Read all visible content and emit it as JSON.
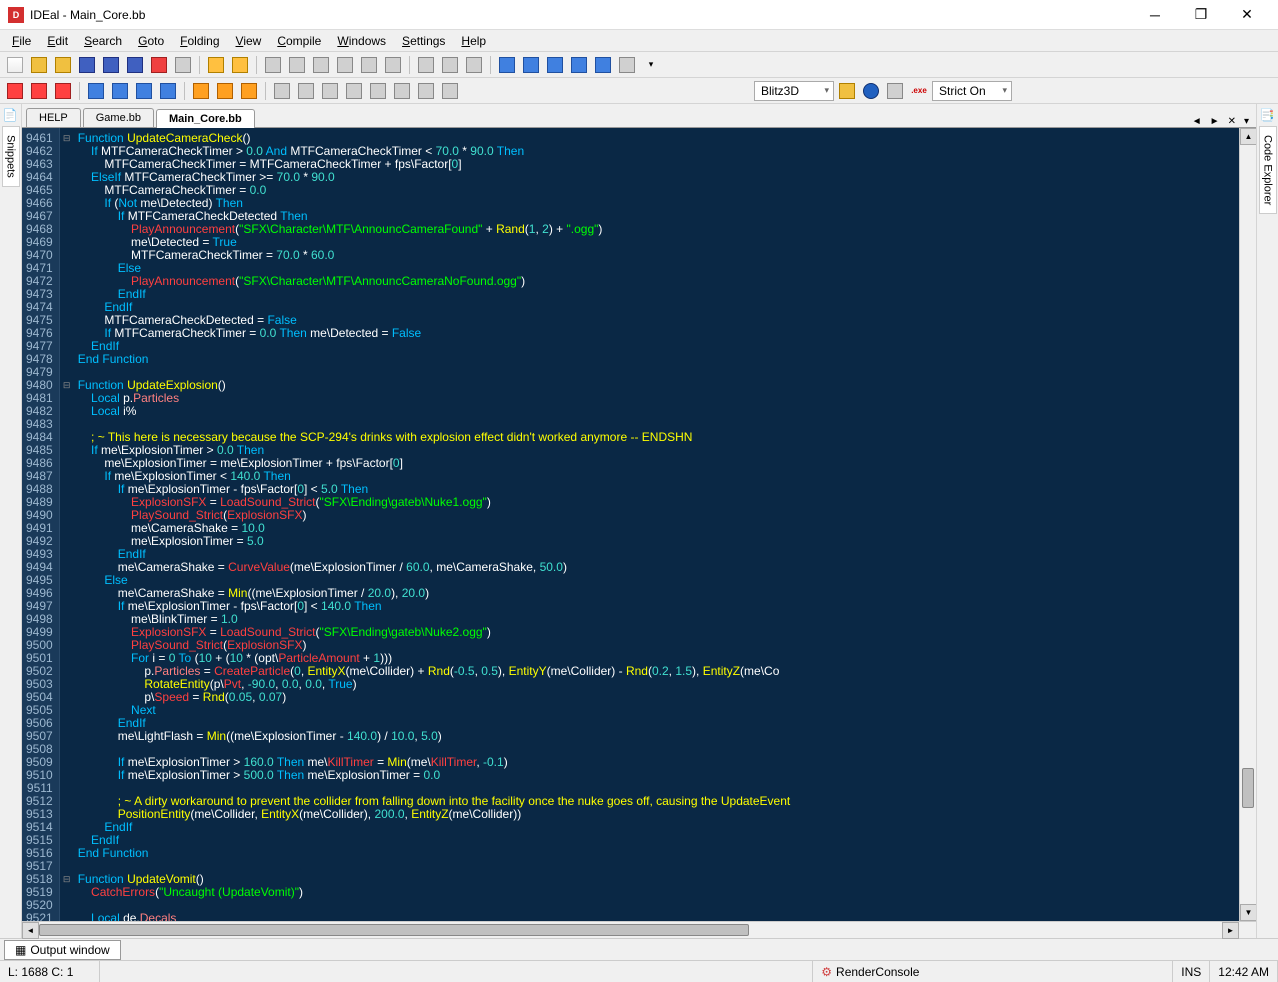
{
  "window": {
    "title": "IDEal - Main_Core.bb",
    "app_icon_text": "D"
  },
  "menu": {
    "items": [
      "File",
      "Edit",
      "Search",
      "Goto",
      "Folding",
      "View",
      "Compile",
      "Windows",
      "Settings",
      "Help"
    ]
  },
  "toolbar2": {
    "compiler": "Blitz3D",
    "strict": "Strict On"
  },
  "side_left": {
    "label": "Snippets"
  },
  "side_right": {
    "label": "Code Explorer"
  },
  "tabs": {
    "items": [
      "HELP",
      "Game.bb",
      "Main_Core.bb"
    ],
    "active_index": 2
  },
  "gutter": {
    "start": 9461,
    "end": 9521
  },
  "code_lines": [
    [
      [
        "kw",
        "Function "
      ],
      [
        "fn",
        "UpdateCameraCheck"
      ],
      [
        "op",
        "()"
      ]
    ],
    [
      [
        "op",
        "    "
      ],
      [
        "kw",
        "If"
      ],
      [
        "op",
        " MTFCameraCheckTimer > "
      ],
      [
        "num",
        "0.0"
      ],
      [
        "op",
        " "
      ],
      [
        "kw",
        "And"
      ],
      [
        "op",
        " MTFCameraCheckTimer < "
      ],
      [
        "num",
        "70.0"
      ],
      [
        "op",
        " * "
      ],
      [
        "num",
        "90.0"
      ],
      [
        "op",
        " "
      ],
      [
        "kw",
        "Then"
      ]
    ],
    [
      [
        "op",
        "        MTFCameraCheckTimer = MTFCameraCheckTimer + fps\\Factor["
      ],
      [
        "num",
        "0"
      ],
      [
        "op",
        "]"
      ]
    ],
    [
      [
        "op",
        "    "
      ],
      [
        "kw",
        "ElseIf"
      ],
      [
        "op",
        " MTFCameraCheckTimer >= "
      ],
      [
        "num",
        "70.0"
      ],
      [
        "op",
        " * "
      ],
      [
        "num",
        "90.0"
      ]
    ],
    [
      [
        "op",
        "        MTFCameraCheckTimer = "
      ],
      [
        "num",
        "0.0"
      ]
    ],
    [
      [
        "op",
        "        "
      ],
      [
        "kw",
        "If"
      ],
      [
        "op",
        " ("
      ],
      [
        "kw",
        "Not"
      ],
      [
        "op",
        " me\\Detected) "
      ],
      [
        "kw",
        "Then"
      ]
    ],
    [
      [
        "op",
        "            "
      ],
      [
        "kw",
        "If"
      ],
      [
        "op",
        " MTFCameraCheckDetected "
      ],
      [
        "kw",
        "Then"
      ]
    ],
    [
      [
        "op",
        "                "
      ],
      [
        "err",
        "PlayAnnouncement"
      ],
      [
        "op",
        "("
      ],
      [
        "str",
        "\"SFX\\Character\\MTF\\AnnouncCameraFound\""
      ],
      [
        "op",
        " + "
      ],
      [
        "fn",
        "Rand"
      ],
      [
        "op",
        "("
      ],
      [
        "num",
        "1"
      ],
      [
        "op",
        ", "
      ],
      [
        "num",
        "2"
      ],
      [
        "op",
        ") + "
      ],
      [
        "str",
        "\".ogg\""
      ],
      [
        "op",
        ")"
      ]
    ],
    [
      [
        "op",
        "                me\\Detected = "
      ],
      [
        "kw",
        "True"
      ]
    ],
    [
      [
        "op",
        "                MTFCameraCheckTimer = "
      ],
      [
        "num",
        "70.0"
      ],
      [
        "op",
        " * "
      ],
      [
        "num",
        "60.0"
      ]
    ],
    [
      [
        "op",
        "            "
      ],
      [
        "kw",
        "Else"
      ]
    ],
    [
      [
        "op",
        "                "
      ],
      [
        "err",
        "PlayAnnouncement"
      ],
      [
        "op",
        "("
      ],
      [
        "str",
        "\"SFX\\Character\\MTF\\AnnouncCameraNoFound.ogg\""
      ],
      [
        "op",
        ")"
      ]
    ],
    [
      [
        "op",
        "            "
      ],
      [
        "kw",
        "EndIf"
      ]
    ],
    [
      [
        "op",
        "        "
      ],
      [
        "kw",
        "EndIf"
      ]
    ],
    [
      [
        "op",
        "        MTFCameraCheckDetected = "
      ],
      [
        "kw",
        "False"
      ]
    ],
    [
      [
        "op",
        "        "
      ],
      [
        "kw",
        "If"
      ],
      [
        "op",
        " MTFCameraCheckTimer = "
      ],
      [
        "num",
        "0.0"
      ],
      [
        "op",
        " "
      ],
      [
        "kw",
        "Then"
      ],
      [
        "op",
        " me\\Detected = "
      ],
      [
        "kw",
        "False"
      ]
    ],
    [
      [
        "op",
        "    "
      ],
      [
        "kw",
        "EndIf"
      ]
    ],
    [
      [
        "kw",
        "End Function"
      ]
    ],
    [
      [
        "op",
        ""
      ]
    ],
    [
      [
        "kw",
        "Function "
      ],
      [
        "fn",
        "UpdateExplosion"
      ],
      [
        "op",
        "()"
      ]
    ],
    [
      [
        "op",
        "    "
      ],
      [
        "kw",
        "Local"
      ],
      [
        "op",
        " p."
      ],
      [
        "typ",
        "Particles"
      ]
    ],
    [
      [
        "op",
        "    "
      ],
      [
        "kw",
        "Local"
      ],
      [
        "op",
        " i%"
      ]
    ],
    [
      [
        "op",
        ""
      ]
    ],
    [
      [
        "op",
        "    "
      ],
      [
        "cmt",
        "; ~ This here is necessary because the SCP-294's drinks with explosion effect didn't worked anymore -- ENDSHN"
      ]
    ],
    [
      [
        "op",
        "    "
      ],
      [
        "kw",
        "If"
      ],
      [
        "op",
        " me\\ExplosionTimer > "
      ],
      [
        "num",
        "0.0"
      ],
      [
        "op",
        " "
      ],
      [
        "kw",
        "Then"
      ]
    ],
    [
      [
        "op",
        "        me\\ExplosionTimer = me\\ExplosionTimer + fps\\Factor["
      ],
      [
        "num",
        "0"
      ],
      [
        "op",
        "]"
      ]
    ],
    [
      [
        "op",
        "        "
      ],
      [
        "kw",
        "If"
      ],
      [
        "op",
        " me\\ExplosionTimer < "
      ],
      [
        "num",
        "140.0"
      ],
      [
        "op",
        " "
      ],
      [
        "kw",
        "Then"
      ]
    ],
    [
      [
        "op",
        "            "
      ],
      [
        "kw",
        "If"
      ],
      [
        "op",
        " me\\ExplosionTimer - fps\\Factor["
      ],
      [
        "num",
        "0"
      ],
      [
        "op",
        "] < "
      ],
      [
        "num",
        "5.0"
      ],
      [
        "op",
        " "
      ],
      [
        "kw",
        "Then"
      ]
    ],
    [
      [
        "op",
        "                "
      ],
      [
        "err",
        "ExplosionSFX"
      ],
      [
        "op",
        " = "
      ],
      [
        "err",
        "LoadSound_Strict"
      ],
      [
        "op",
        "("
      ],
      [
        "str",
        "\"SFX\\Ending\\gateb\\Nuke1.ogg\""
      ],
      [
        "op",
        ")"
      ]
    ],
    [
      [
        "op",
        "                "
      ],
      [
        "err",
        "PlaySound_Strict"
      ],
      [
        "op",
        "("
      ],
      [
        "err",
        "ExplosionSFX"
      ],
      [
        "op",
        ")"
      ]
    ],
    [
      [
        "op",
        "                me\\CameraShake = "
      ],
      [
        "num",
        "10.0"
      ]
    ],
    [
      [
        "op",
        "                me\\ExplosionTimer = "
      ],
      [
        "num",
        "5.0"
      ]
    ],
    [
      [
        "op",
        "            "
      ],
      [
        "kw",
        "EndIf"
      ]
    ],
    [
      [
        "op",
        "            me\\CameraShake = "
      ],
      [
        "err",
        "CurveValue"
      ],
      [
        "op",
        "(me\\ExplosionTimer / "
      ],
      [
        "num",
        "60.0"
      ],
      [
        "op",
        ", me\\CameraShake, "
      ],
      [
        "num",
        "50.0"
      ],
      [
        "op",
        ")"
      ]
    ],
    [
      [
        "op",
        "        "
      ],
      [
        "kw",
        "Else"
      ]
    ],
    [
      [
        "op",
        "            me\\CameraShake = "
      ],
      [
        "fn",
        "Min"
      ],
      [
        "op",
        "((me\\ExplosionTimer / "
      ],
      [
        "num",
        "20.0"
      ],
      [
        "op",
        "), "
      ],
      [
        "num",
        "20.0"
      ],
      [
        "op",
        ")"
      ]
    ],
    [
      [
        "op",
        "            "
      ],
      [
        "kw",
        "If"
      ],
      [
        "op",
        " me\\ExplosionTimer - fps\\Factor["
      ],
      [
        "num",
        "0"
      ],
      [
        "op",
        "] < "
      ],
      [
        "num",
        "140.0"
      ],
      [
        "op",
        " "
      ],
      [
        "kw",
        "Then"
      ]
    ],
    [
      [
        "op",
        "                me\\BlinkTimer = "
      ],
      [
        "num",
        "1.0"
      ]
    ],
    [
      [
        "op",
        "                "
      ],
      [
        "err",
        "ExplosionSFX"
      ],
      [
        "op",
        " = "
      ],
      [
        "err",
        "LoadSound_Strict"
      ],
      [
        "op",
        "("
      ],
      [
        "str",
        "\"SFX\\Ending\\gateb\\Nuke2.ogg\""
      ],
      [
        "op",
        ")"
      ]
    ],
    [
      [
        "op",
        "                "
      ],
      [
        "err",
        "PlaySound_Strict"
      ],
      [
        "op",
        "("
      ],
      [
        "err",
        "ExplosionSFX"
      ],
      [
        "op",
        ")"
      ]
    ],
    [
      [
        "op",
        "                "
      ],
      [
        "kw",
        "For"
      ],
      [
        "op",
        " i = "
      ],
      [
        "num",
        "0"
      ],
      [
        "op",
        " "
      ],
      [
        "kw",
        "To"
      ],
      [
        "op",
        " ("
      ],
      [
        "num",
        "10"
      ],
      [
        "op",
        " + ("
      ],
      [
        "num",
        "10"
      ],
      [
        "op",
        " * (opt\\"
      ],
      [
        "err",
        "ParticleAmount"
      ],
      [
        "op",
        " + "
      ],
      [
        "num",
        "1"
      ],
      [
        "op",
        ")))"
      ]
    ],
    [
      [
        "op",
        "                    p."
      ],
      [
        "typ",
        "Particles"
      ],
      [
        "op",
        " = "
      ],
      [
        "err",
        "CreateParticle"
      ],
      [
        "op",
        "("
      ],
      [
        "num",
        "0"
      ],
      [
        "op",
        ", "
      ],
      [
        "fn",
        "EntityX"
      ],
      [
        "op",
        "(me\\Collider) + "
      ],
      [
        "fn",
        "Rnd"
      ],
      [
        "op",
        "("
      ],
      [
        "num",
        "-0.5"
      ],
      [
        "op",
        ", "
      ],
      [
        "num",
        "0.5"
      ],
      [
        "op",
        "), "
      ],
      [
        "fn",
        "EntityY"
      ],
      [
        "op",
        "(me\\Collider) - "
      ],
      [
        "fn",
        "Rnd"
      ],
      [
        "op",
        "("
      ],
      [
        "num",
        "0.2"
      ],
      [
        "op",
        ", "
      ],
      [
        "num",
        "1.5"
      ],
      [
        "op",
        "), "
      ],
      [
        "fn",
        "EntityZ"
      ],
      [
        "op",
        "(me\\Co"
      ]
    ],
    [
      [
        "op",
        "                    "
      ],
      [
        "fn",
        "RotateEntity"
      ],
      [
        "op",
        "(p\\"
      ],
      [
        "err",
        "Pvt"
      ],
      [
        "op",
        ", "
      ],
      [
        "num",
        "-90.0"
      ],
      [
        "op",
        ", "
      ],
      [
        "num",
        "0.0"
      ],
      [
        "op",
        ", "
      ],
      [
        "num",
        "0.0"
      ],
      [
        "op",
        ", "
      ],
      [
        "kw",
        "True"
      ],
      [
        "op",
        ")"
      ]
    ],
    [
      [
        "op",
        "                    p\\"
      ],
      [
        "err",
        "Speed"
      ],
      [
        "op",
        " = "
      ],
      [
        "fn",
        "Rnd"
      ],
      [
        "op",
        "("
      ],
      [
        "num",
        "0.05"
      ],
      [
        "op",
        ", "
      ],
      [
        "num",
        "0.07"
      ],
      [
        "op",
        ")"
      ]
    ],
    [
      [
        "op",
        "                "
      ],
      [
        "kw",
        "Next"
      ]
    ],
    [
      [
        "op",
        "            "
      ],
      [
        "kw",
        "EndIf"
      ]
    ],
    [
      [
        "op",
        "            me\\LightFlash = "
      ],
      [
        "fn",
        "Min"
      ],
      [
        "op",
        "((me\\ExplosionTimer - "
      ],
      [
        "num",
        "140.0"
      ],
      [
        "op",
        ") / "
      ],
      [
        "num",
        "10.0"
      ],
      [
        "op",
        ", "
      ],
      [
        "num",
        "5.0"
      ],
      [
        "op",
        ")"
      ]
    ],
    [
      [
        "op",
        ""
      ]
    ],
    [
      [
        "op",
        "            "
      ],
      [
        "kw",
        "If"
      ],
      [
        "op",
        " me\\ExplosionTimer > "
      ],
      [
        "num",
        "160.0"
      ],
      [
        "op",
        " "
      ],
      [
        "kw",
        "Then"
      ],
      [
        "op",
        " me\\"
      ],
      [
        "err",
        "KillTimer"
      ],
      [
        "op",
        " = "
      ],
      [
        "fn",
        "Min"
      ],
      [
        "op",
        "(me\\"
      ],
      [
        "err",
        "KillTimer"
      ],
      [
        "op",
        ", "
      ],
      [
        "num",
        "-0.1"
      ],
      [
        "op",
        ")"
      ]
    ],
    [
      [
        "op",
        "            "
      ],
      [
        "kw",
        "If"
      ],
      [
        "op",
        " me\\ExplosionTimer > "
      ],
      [
        "num",
        "500.0"
      ],
      [
        "op",
        " "
      ],
      [
        "kw",
        "Then"
      ],
      [
        "op",
        " me\\ExplosionTimer = "
      ],
      [
        "num",
        "0.0"
      ]
    ],
    [
      [
        "op",
        ""
      ]
    ],
    [
      [
        "op",
        "            "
      ],
      [
        "cmt",
        "; ~ A dirty workaround to prevent the collider from falling down into the facility once the nuke goes off, causing the UpdateEvent"
      ]
    ],
    [
      [
        "op",
        "            "
      ],
      [
        "fn",
        "PositionEntity"
      ],
      [
        "op",
        "(me\\Collider, "
      ],
      [
        "fn",
        "EntityX"
      ],
      [
        "op",
        "(me\\Collider), "
      ],
      [
        "num",
        "200.0"
      ],
      [
        "op",
        ", "
      ],
      [
        "fn",
        "EntityZ"
      ],
      [
        "op",
        "(me\\Collider))"
      ]
    ],
    [
      [
        "op",
        "        "
      ],
      [
        "kw",
        "EndIf"
      ]
    ],
    [
      [
        "op",
        "    "
      ],
      [
        "kw",
        "EndIf"
      ]
    ],
    [
      [
        "kw",
        "End Function"
      ]
    ],
    [
      [
        "op",
        ""
      ]
    ],
    [
      [
        "kw",
        "Function "
      ],
      [
        "fn",
        "UpdateVomit"
      ],
      [
        "op",
        "()"
      ]
    ],
    [
      [
        "op",
        "    "
      ],
      [
        "err",
        "CatchErrors"
      ],
      [
        "op",
        "("
      ],
      [
        "str",
        "\"Uncaught (UpdateVomit)\""
      ],
      [
        "op",
        ")"
      ]
    ],
    [
      [
        "op",
        ""
      ]
    ],
    [
      [
        "op",
        "    "
      ],
      [
        "kw",
        "Local"
      ],
      [
        "op",
        " de."
      ],
      [
        "typ",
        "Decals"
      ]
    ]
  ],
  "fold_markers": {
    "0": "⊟",
    "19": "⊟",
    "57": "⊟"
  },
  "output": {
    "label": "Output window"
  },
  "status": {
    "pos": "L: 1688 C: 1",
    "process": "RenderConsole",
    "ins": "INS",
    "time": "12:42 AM"
  }
}
